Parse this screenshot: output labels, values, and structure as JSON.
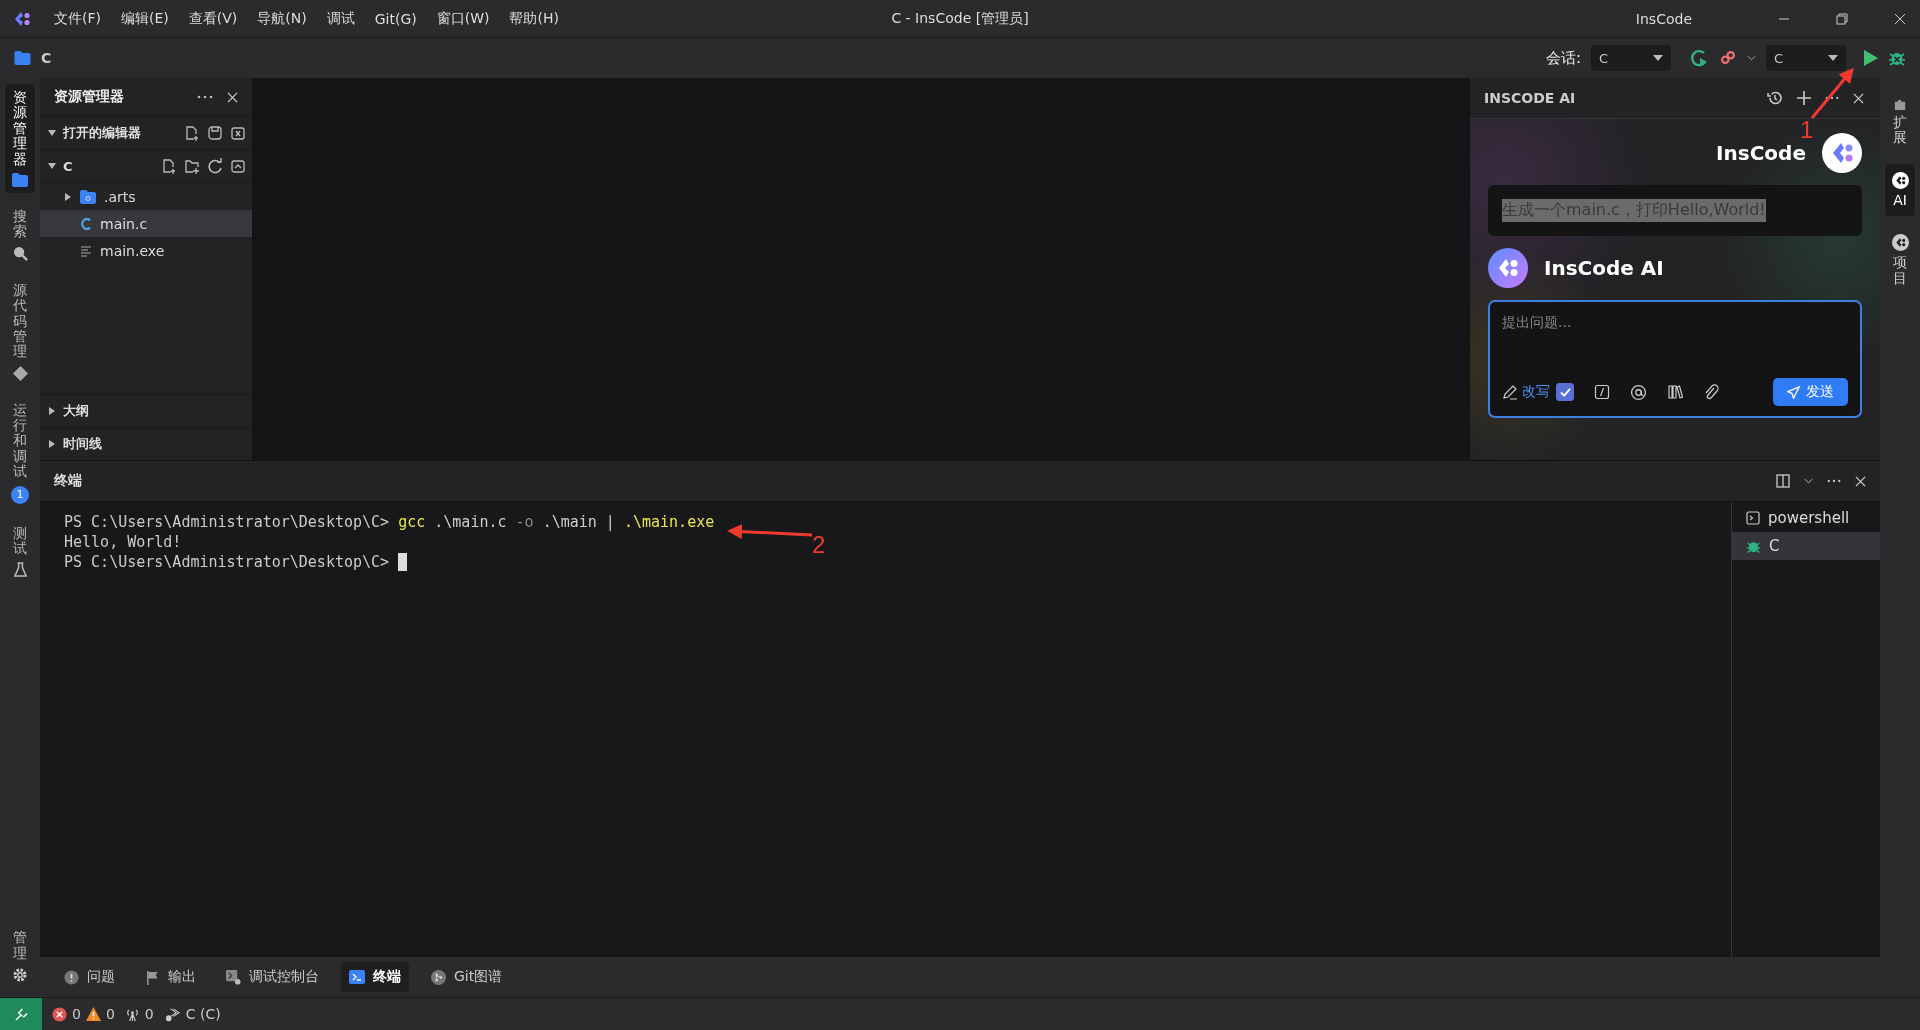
{
  "title_bar": {
    "menu": [
      "文件(F)",
      "编辑(E)",
      "查看(V)",
      "导航(N)",
      "调试",
      "Git(G)",
      "窗口(W)",
      "帮助(H)"
    ],
    "title": "C - InsCode [管理员]",
    "app_name": "InsCode"
  },
  "toolbar": {
    "workspace": "C",
    "session_label": "会话:",
    "session_value": "C",
    "config_value": "C"
  },
  "activity_bar": {
    "items": [
      {
        "label": "资源管理器",
        "kind": "explorer",
        "selected": true
      },
      {
        "label": "搜索",
        "kind": "search",
        "selected": false
      },
      {
        "label": "源代码管理",
        "kind": "scm",
        "selected": false
      },
      {
        "label": "运行和调试",
        "kind": "debug",
        "selected": false,
        "badge": "1"
      },
      {
        "label": "测试",
        "kind": "test",
        "selected": false
      }
    ],
    "bottom_item": {
      "label": "管理"
    }
  },
  "explorer": {
    "title": "资源管理器",
    "open_editors": {
      "label": "打开的编辑器",
      "expanded": true
    },
    "folder": {
      "label": "C",
      "expanded": true,
      "children": [
        {
          "name": ".arts",
          "kind": "folder",
          "expanded": false,
          "selected": false
        },
        {
          "name": "main.c",
          "kind": "c",
          "selected": true
        },
        {
          "name": "main.exe",
          "kind": "file",
          "selected": false
        }
      ]
    },
    "collapsed_sections": [
      {
        "label": "大纲",
        "expanded": false
      },
      {
        "label": "时间线",
        "expanded": false
      }
    ]
  },
  "ai_panel": {
    "title": "INSCODE AI",
    "user_name": "InsCode",
    "user_message": "生成一个main.c，打印Hello,World!",
    "assistant_name": "InsCode AI",
    "input": {
      "placeholder": "提出问题..."
    },
    "rewrite_label": "改写",
    "rewrite_checked": true,
    "send_label": "发送"
  },
  "right_bar": {
    "items": [
      {
        "label": "扩展",
        "selected": false
      },
      {
        "label": "AI",
        "selected": true
      },
      {
        "label": "项目",
        "selected": false
      }
    ]
  },
  "terminal": {
    "title": "终端",
    "lines": [
      [
        {
          "text": "PS C:\\Users\\Administrator\\Desktop\\C> ",
          "kind": "plain"
        },
        {
          "text": "gcc",
          "kind": "command"
        },
        {
          "text": " .\\main.c ",
          "kind": "plain"
        },
        {
          "text": "-o",
          "kind": "flag"
        },
        {
          "text": " .\\main | ",
          "kind": "plain"
        },
        {
          "text": ".\\main.exe",
          "kind": "command"
        }
      ],
      [
        {
          "text": "Hello, World!",
          "kind": "plain"
        }
      ],
      [
        {
          "text": "PS C:\\Users\\Administrator\\Desktop\\C> ",
          "kind": "plain"
        },
        {
          "kind": "cursor"
        }
      ]
    ],
    "sessions": [
      {
        "label": "powershell",
        "kind": "shell",
        "selected": false
      },
      {
        "label": "C",
        "kind": "debug",
        "selected": true
      }
    ]
  },
  "panel_tabs": [
    {
      "label": "问题",
      "kind": "problems",
      "selected": false
    },
    {
      "label": "输出",
      "kind": "output",
      "selected": false
    },
    {
      "label": "调试控制台",
      "kind": "debug",
      "selected": false
    },
    {
      "label": "终端",
      "kind": "terminal",
      "selected": true
    },
    {
      "label": "Git图谱",
      "kind": "git",
      "selected": false
    }
  ],
  "status_bar": {
    "errors": "0",
    "warnings": "0",
    "ports": "0",
    "config": "C (C)"
  },
  "annotations": [
    {
      "label": "1"
    },
    {
      "label": "2"
    }
  ]
}
